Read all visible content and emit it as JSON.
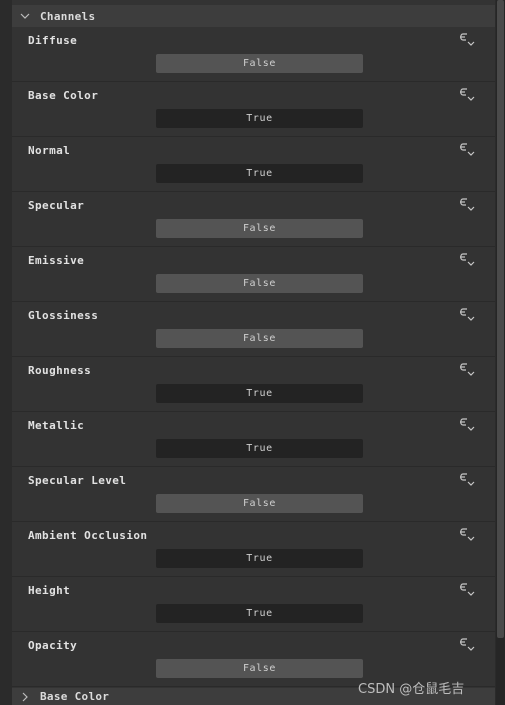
{
  "section": {
    "title": "Channels",
    "expanded": true
  },
  "channels": [
    {
      "label": "Diffuse",
      "value": "False"
    },
    {
      "label": "Base Color",
      "value": "True"
    },
    {
      "label": "Normal",
      "value": "True"
    },
    {
      "label": "Specular",
      "value": "False"
    },
    {
      "label": "Emissive",
      "value": "False"
    },
    {
      "label": "Glossiness",
      "value": "False"
    },
    {
      "label": "Roughness",
      "value": "True"
    },
    {
      "label": "Metallic",
      "value": "True"
    },
    {
      "label": "Specular Level",
      "value": "False"
    },
    {
      "label": "Ambient Occlusion",
      "value": "True"
    },
    {
      "label": "Height",
      "value": "True"
    },
    {
      "label": "Opacity",
      "value": "False"
    }
  ],
  "next_section": {
    "title": "Base Color",
    "expanded": false
  },
  "watermark": "CSDN @仓鼠毛吉",
  "colors": {
    "false_bg": "#545454",
    "true_bg": "#232323",
    "panel_bg": "#333333",
    "header_bg": "#3d3d3d"
  },
  "icons": {
    "row_action": "link-dropdown-icon",
    "expand": "chevron-down-icon",
    "collapse": "chevron-right-icon"
  }
}
